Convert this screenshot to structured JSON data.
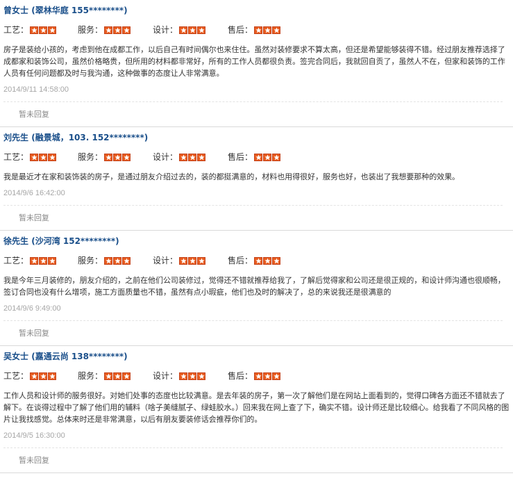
{
  "labels": {
    "gongyi": "工艺：",
    "fuwu": "服务：",
    "sheji": "设计：",
    "shouhou": "售后：",
    "no_reply": "暂未回复"
  },
  "star_color": "#e85d20",
  "name_color": "#1a4f8a",
  "reviews": [
    {
      "name": "曾女士",
      "detail": "(翠林华庭 155********)",
      "ratings": {
        "gongyi": 3,
        "fuwu": 3,
        "sheji": 3,
        "shouhou": 3
      },
      "content": "房子是装给小孩的，考虑到他在成都工作，以后自己有时间偶尔也来住住。虽然对装修要求不算太高，但还是希望能够装得不错。经过朋友推荐选择了成都家和装饰公司，虽然价格略贵，但所用的材料都非常好，所有的工作人员都很负责。签完合同后，我就回自贡了，虽然人不在，但家和装饰的工作人员有任何问题都及时与我沟通，这种做事的态度让人非常满意。",
      "time": "2014/9/11 14:58:00",
      "reply": "暂未回复"
    },
    {
      "name": "刘先生",
      "detail": "(融景城，103. 152********)",
      "ratings": {
        "gongyi": 3,
        "fuwu": 3,
        "sheji": 3,
        "shouhou": 3
      },
      "content": "我是最近才在家和装饰装的房子，是通过朋友介绍过去的，装的都挺满意的，材料也用得很好，服务也好，也装出了我想要那种的效果。",
      "time": "2014/9/6 16:42:00",
      "reply": "暂未回复"
    },
    {
      "name": "徐先生",
      "detail": "(沙河湾 152********)",
      "ratings": {
        "gongyi": 3,
        "fuwu": 3,
        "sheji": 3,
        "shouhou": 3
      },
      "content": "我是今年三月装修的，朋友介绍的，之前在他们公司装修过，觉得还不错就推荐给我了，了解后觉得家和公司还是很正规的，和设计师沟通也很顺畅，签订合同也没有什么增项，施工方面质量也不错，虽然有点小瑕疵，他们也及时的解决了，总的来说我还是很满意的",
      "time": "2014/9/6 9:49:00",
      "reply": "暂未回复"
    },
    {
      "name": "吴女士",
      "detail": "(嘉通云尚 138********)",
      "ratings": {
        "gongyi": 3,
        "fuwu": 3,
        "sheji": 3,
        "shouhou": 3
      },
      "content": "工作人员和设计师的服务很好。对她们处事的态度也比较满意。是去年装的房子，第一次了解他们是在网站上面看到的，觉得口碑各方面还不错就去了解下。在谈得过程中了解了他们用的辅料（啥子美缝腻子、绿蛙胶水。）回来我在网上查了下，确实不错。设计师还是比较细心。给我看了不同风格的图片让我找感觉。总体来时还是非常满意，以后有朋友要装修话会推荐你们的。",
      "time": "2014/9/5 16:30:00",
      "reply": "暂未回复"
    }
  ]
}
